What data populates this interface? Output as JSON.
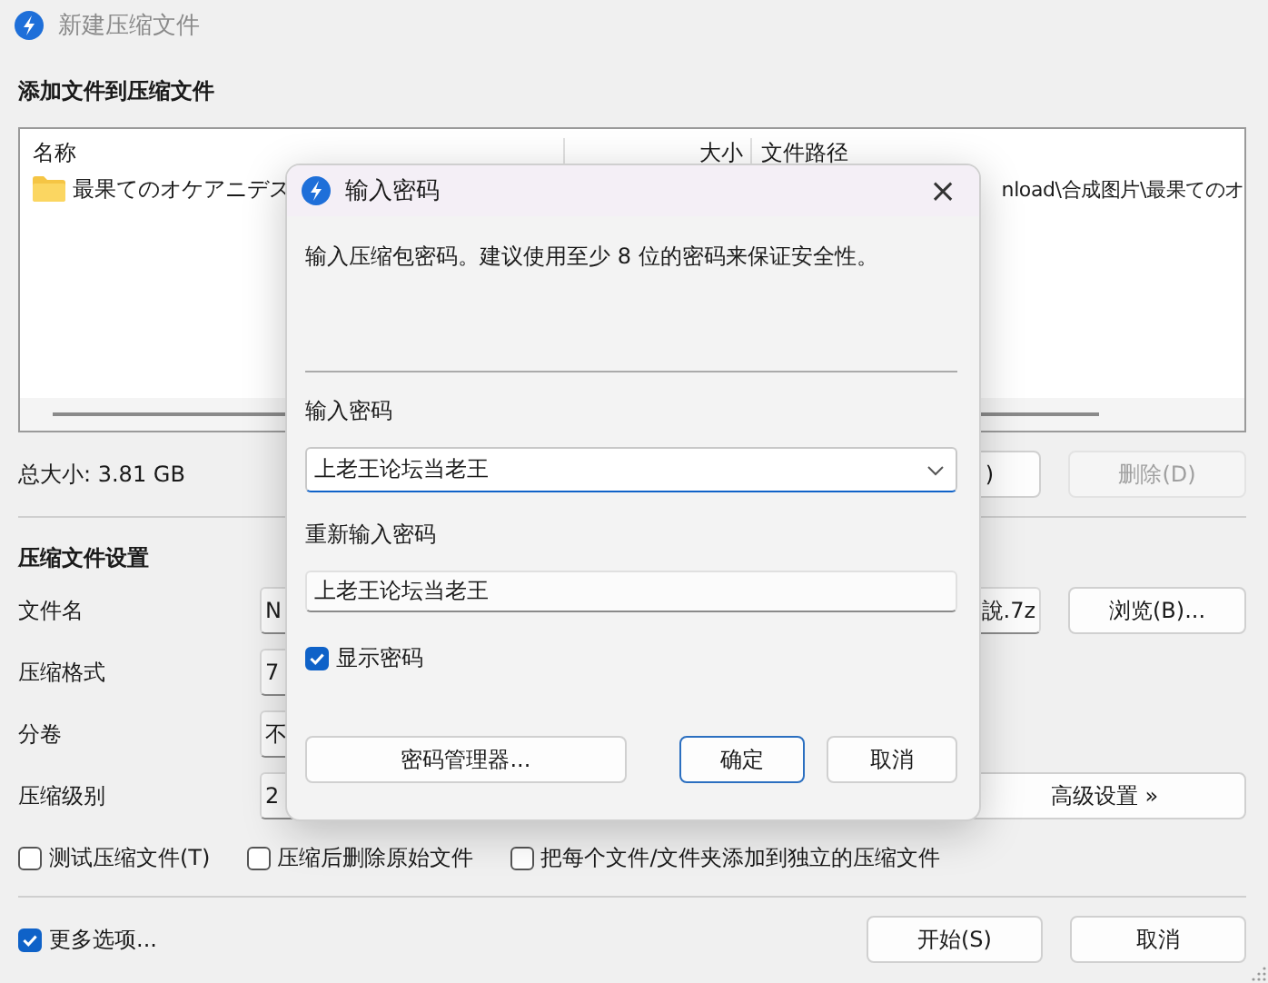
{
  "window": {
    "title": "新建压缩文件"
  },
  "files": {
    "heading": "添加文件到压缩文件",
    "columns": [
      "名称",
      "大小",
      "文件路径"
    ],
    "rows": [
      {
        "name": "最果てのオケアニデス",
        "path": "nload\\合成图片\\最果てのオ"
      }
    ],
    "total": "总大小: 3.81 GB",
    "buttons": [
      {
        "label": ")",
        "disabled": false
      },
      {
        "label": "删除(D)",
        "disabled": true
      }
    ]
  },
  "settings": {
    "heading": "压缩文件设置",
    "rows": [
      {
        "label": "文件名",
        "value": "N",
        "value_end": "說.7z",
        "button": "浏览(B)..."
      },
      {
        "label": "压缩格式",
        "value": "7"
      },
      {
        "label": "分卷",
        "value": "不"
      },
      {
        "label": "压缩级别",
        "value": "2",
        "button": "高级设置 »"
      }
    ],
    "options": [
      {
        "label": "测试压缩文件(T)",
        "checked": false
      },
      {
        "label": "压缩后删除原始文件",
        "checked": false
      },
      {
        "label": "把每个文件/文件夹添加到独立的压缩文件",
        "checked": false
      }
    ]
  },
  "footer": {
    "more": {
      "label": "更多选项...",
      "checked": true
    },
    "buttons": [
      "开始(S)",
      "取消"
    ]
  },
  "dialog": {
    "title": "输入密码",
    "close": "×",
    "message": "输入压缩包密码。建议使用至少 8 位的密码来保证安全性。",
    "password_label": "输入密码",
    "password": "上老王论坛当老王",
    "confirm_label": "重新输入密码",
    "confirm": "上老王论坛当老王",
    "show_password": {
      "label": "显示密码",
      "checked": true
    },
    "manager_button": "密码管理器...",
    "ok_button": "确定",
    "cancel_button": "取消"
  }
}
